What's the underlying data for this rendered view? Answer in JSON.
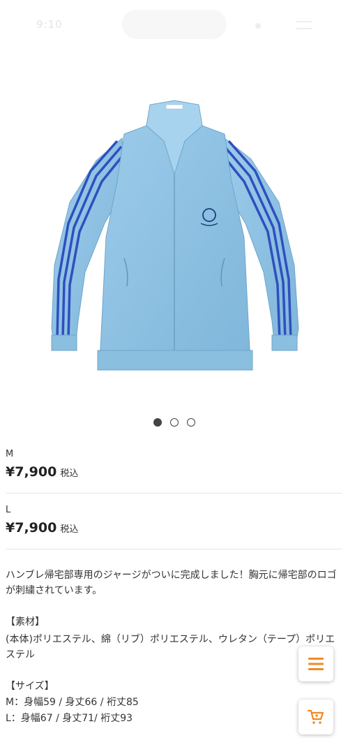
{
  "status": {
    "time": "9:10"
  },
  "carousel": {
    "count": 3,
    "active": 0
  },
  "variants": [
    {
      "size": "M",
      "price": "¥7,900",
      "tax": "税込"
    },
    {
      "size": "L",
      "price": "¥7,900",
      "tax": "税込"
    }
  ],
  "description": {
    "intro": "ハンブレ帰宅部専用のジャージがついに完成しました！胸元に帰宅部のロゴが刺繍されています。",
    "material_heading": "【素材】",
    "material_text": "(本体)ポリエステル、綿（リブ）ポリエステル、ウレタン（テープ）ポリエステル",
    "size_heading": "【サイズ】",
    "size_m": "M：身幅59 / 身丈66 / 裄丈85",
    "size_l": "L：身幅67 / 身丈71/ 裄丈93"
  },
  "colors": {
    "accent": "#f08a24",
    "jacket": "#8fc3e4",
    "stripe": "#2f4fbf"
  },
  "icons": {
    "menu": "hamburger-menu-icon",
    "cart": "cart-icon"
  }
}
